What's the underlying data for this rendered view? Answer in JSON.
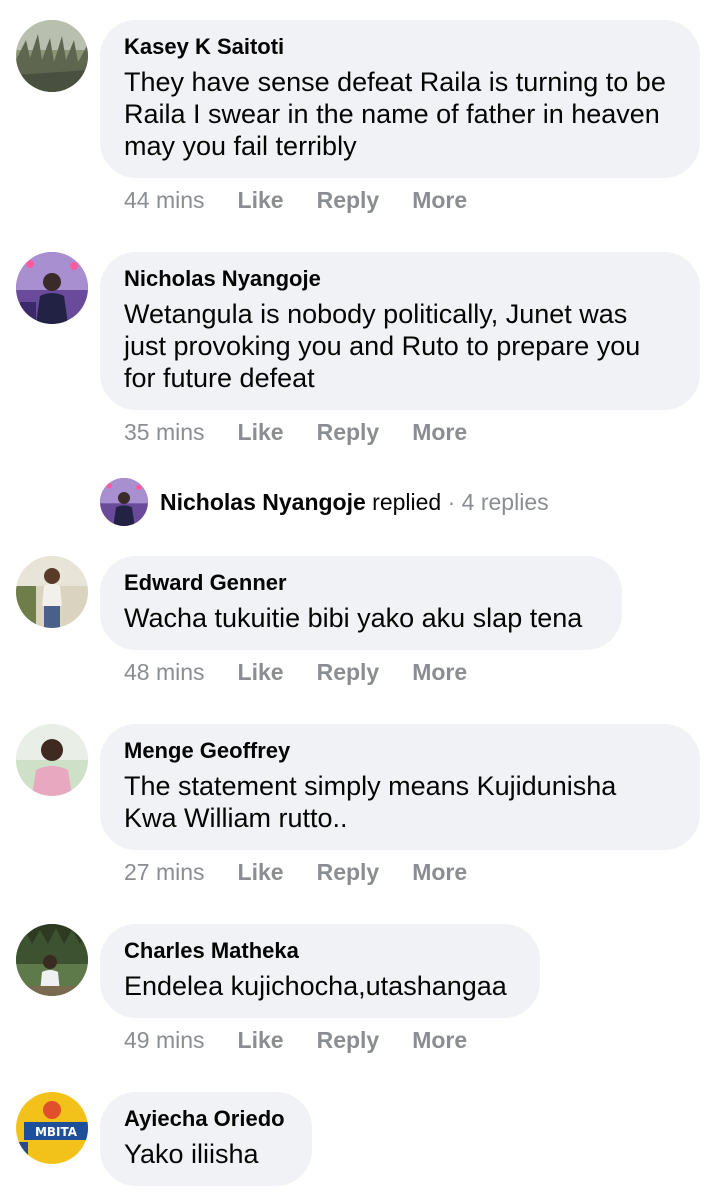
{
  "actions": {
    "like": "Like",
    "reply": "Reply",
    "more": "More"
  },
  "comments": [
    {
      "author": "Kasey K Saitoti",
      "text": "They have sense defeat Raila is turning to be Raila I swear in the name of father in heaven may you fail terribly",
      "time": "44 mins",
      "avatar": "avatar-landscape-icon"
    },
    {
      "author": "Nicholas Nyangoje",
      "text": "Wetangula is nobody politically, Junet was just provoking you and Ruto to prepare you for future defeat",
      "time": "35 mins",
      "avatar": "avatar-person-purple-icon"
    },
    {
      "author": "Edward Genner",
      "text": "Wacha tukuitie bibi yako aku slap tena",
      "time": "48 mins",
      "avatar": "avatar-person-outdoor-icon"
    },
    {
      "author": "Menge Geoffrey",
      "text": "The statement simply means Kujidunisha Kwa William rutto..",
      "time": "27 mins",
      "avatar": "avatar-person-pink-shirt-icon"
    },
    {
      "author": "Charles Matheka",
      "text": "Endelea kujichocha,utashangaa",
      "time": "49 mins",
      "avatar": "avatar-person-trees-icon"
    },
    {
      "author": "Ayiecha Oriedo",
      "text": "Yako iliisha",
      "time": "",
      "avatar": "avatar-mbita-sign-icon"
    }
  ],
  "replies": {
    "name": "Nicholas Nyangoje",
    "verb": "replied",
    "sep": " · ",
    "count": "4 replies"
  },
  "mbita_sign_text": "MBITA"
}
